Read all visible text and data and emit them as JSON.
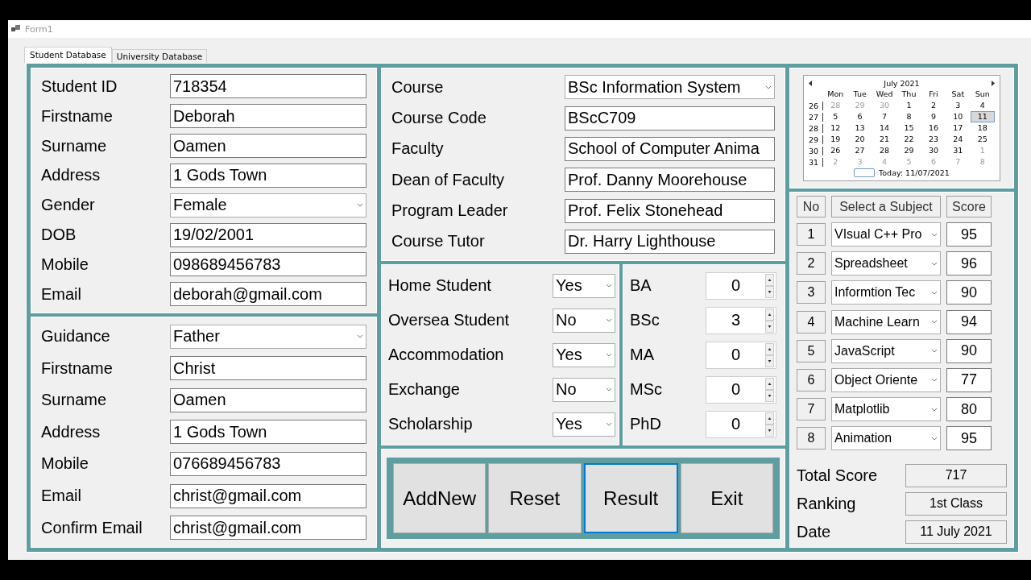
{
  "window": {
    "title": "Form1"
  },
  "tabs": [
    {
      "label": "Student Database",
      "selected": true
    },
    {
      "label": "University Database",
      "selected": false
    }
  ],
  "student": [
    {
      "label": "Student ID",
      "kind": "text",
      "value": "718354"
    },
    {
      "label": "Firstname",
      "kind": "text",
      "value": "Deborah"
    },
    {
      "label": "Surname",
      "kind": "text",
      "value": "Oamen"
    },
    {
      "label": "Address",
      "kind": "text",
      "value": "1 Gods Town"
    },
    {
      "label": "Gender",
      "kind": "dropdown",
      "value": "Female"
    },
    {
      "label": "DOB",
      "kind": "text",
      "value": "19/02/2001"
    },
    {
      "label": "Mobile",
      "kind": "text",
      "value": "098689456783"
    },
    {
      "label": "Email",
      "kind": "text",
      "value": "deborah@gmail.com"
    }
  ],
  "guardian": [
    {
      "label": "Guidance",
      "kind": "dropdown",
      "value": "Father"
    },
    {
      "label": "Firstname",
      "kind": "text",
      "value": "Christ"
    },
    {
      "label": "Surname",
      "kind": "text",
      "value": "Oamen"
    },
    {
      "label": "Address",
      "kind": "text",
      "value": "1 Gods Town"
    },
    {
      "label": "Mobile",
      "kind": "text",
      "value": "076689456783"
    },
    {
      "label": "Email",
      "kind": "text",
      "value": "christ@gmail.com"
    },
    {
      "label": "Confirm Email",
      "kind": "text",
      "value": "christ@gmail.com"
    }
  ],
  "course": [
    {
      "label": "Course",
      "kind": "dropdown",
      "value": "BSc Information System"
    },
    {
      "label": "Course Code",
      "kind": "text",
      "value": "BScC709"
    },
    {
      "label": "Faculty",
      "kind": "text",
      "value": "School of Computer Anima"
    },
    {
      "label": "Dean of Faculty",
      "kind": "text",
      "value": "Prof. Danny Moorehouse"
    },
    {
      "label": "Program Leader",
      "kind": "text",
      "value": "Prof. Felix Stonehead"
    },
    {
      "label": "Course Tutor",
      "kind": "text",
      "value": "Dr. Harry Lighthouse"
    }
  ],
  "options": [
    {
      "label": "Home Student",
      "value": "Yes"
    },
    {
      "label": "Oversea Student",
      "value": "No"
    },
    {
      "label": "Accommodation",
      "value": "Yes"
    },
    {
      "label": "Exchange",
      "value": "No"
    },
    {
      "label": "Scholarship",
      "value": "Yes"
    }
  ],
  "degrees": [
    {
      "label": "BA",
      "value": "0"
    },
    {
      "label": "BSc",
      "value": "3"
    },
    {
      "label": "MA",
      "value": "0"
    },
    {
      "label": "MSc",
      "value": "0"
    },
    {
      "label": "PhD",
      "value": "0"
    }
  ],
  "buttons": [
    {
      "label": "AddNew",
      "focused": false
    },
    {
      "label": "Reset",
      "focused": false
    },
    {
      "label": "Result",
      "focused": true
    },
    {
      "label": "Exit",
      "focused": false
    }
  ],
  "calendar": {
    "month": "July 2021",
    "weekdays": [
      "Mon",
      "Tue",
      "Wed",
      "Thu",
      "Fri",
      "Sat",
      "Sun"
    ],
    "today": "Today: 11/07/2021",
    "weeks": [
      {
        "week": "26",
        "days": [
          {
            "day": "28",
            "muted": true,
            "selected": false
          },
          {
            "day": "29",
            "muted": true,
            "selected": false
          },
          {
            "day": "30",
            "muted": true,
            "selected": false
          },
          {
            "day": "1",
            "muted": false,
            "selected": false
          },
          {
            "day": "2",
            "muted": false,
            "selected": false
          },
          {
            "day": "3",
            "muted": false,
            "selected": false
          },
          {
            "day": "4",
            "muted": false,
            "selected": false
          }
        ]
      },
      {
        "week": "27",
        "days": [
          {
            "day": "5",
            "muted": false,
            "selected": false
          },
          {
            "day": "6",
            "muted": false,
            "selected": false
          },
          {
            "day": "7",
            "muted": false,
            "selected": false
          },
          {
            "day": "8",
            "muted": false,
            "selected": false
          },
          {
            "day": "9",
            "muted": false,
            "selected": false
          },
          {
            "day": "10",
            "muted": false,
            "selected": false
          },
          {
            "day": "11",
            "muted": false,
            "selected": true
          }
        ]
      },
      {
        "week": "28",
        "days": [
          {
            "day": "12",
            "muted": false,
            "selected": false
          },
          {
            "day": "13",
            "muted": false,
            "selected": false
          },
          {
            "day": "14",
            "muted": false,
            "selected": false
          },
          {
            "day": "15",
            "muted": false,
            "selected": false
          },
          {
            "day": "16",
            "muted": false,
            "selected": false
          },
          {
            "day": "17",
            "muted": false,
            "selected": false
          },
          {
            "day": "18",
            "muted": false,
            "selected": false
          }
        ]
      },
      {
        "week": "29",
        "days": [
          {
            "day": "19",
            "muted": false,
            "selected": false
          },
          {
            "day": "20",
            "muted": false,
            "selected": false
          },
          {
            "day": "21",
            "muted": false,
            "selected": false
          },
          {
            "day": "22",
            "muted": false,
            "selected": false
          },
          {
            "day": "23",
            "muted": false,
            "selected": false
          },
          {
            "day": "24",
            "muted": false,
            "selected": false
          },
          {
            "day": "25",
            "muted": false,
            "selected": false
          }
        ]
      },
      {
        "week": "30",
        "days": [
          {
            "day": "26",
            "muted": false,
            "selected": false
          },
          {
            "day": "27",
            "muted": false,
            "selected": false
          },
          {
            "day": "28",
            "muted": false,
            "selected": false
          },
          {
            "day": "29",
            "muted": false,
            "selected": false
          },
          {
            "day": "30",
            "muted": false,
            "selected": false
          },
          {
            "day": "31",
            "muted": false,
            "selected": false
          },
          {
            "day": "1",
            "muted": true,
            "selected": false
          }
        ]
      },
      {
        "week": "31",
        "days": [
          {
            "day": "2",
            "muted": true,
            "selected": false
          },
          {
            "day": "3",
            "muted": true,
            "selected": false
          },
          {
            "day": "4",
            "muted": true,
            "selected": false
          },
          {
            "day": "5",
            "muted": true,
            "selected": false
          },
          {
            "day": "6",
            "muted": true,
            "selected": false
          },
          {
            "day": "7",
            "muted": true,
            "selected": false
          },
          {
            "day": "8",
            "muted": true,
            "selected": false
          }
        ]
      }
    ]
  },
  "subjects": {
    "headers": [
      "No",
      "Select a Subject",
      "Score"
    ],
    "rows": [
      {
        "no": "1",
        "subject": "VIsual C++ Pro",
        "score": "95"
      },
      {
        "no": "2",
        "subject": "Spreadsheet",
        "score": "96"
      },
      {
        "no": "3",
        "subject": "Informtion Tec",
        "score": "90"
      },
      {
        "no": "4",
        "subject": "Machine Learn",
        "score": "94"
      },
      {
        "no": "5",
        "subject": "JavaScript",
        "score": "90"
      },
      {
        "no": "6",
        "subject": "Object Oriente",
        "score": "77"
      },
      {
        "no": "7",
        "subject": "Matplotlib",
        "score": "80"
      },
      {
        "no": "8",
        "subject": "Animation",
        "score": "95"
      }
    ]
  },
  "summary": [
    {
      "label": "Total Score",
      "value": "717"
    },
    {
      "label": "Ranking",
      "value": "1st Class"
    },
    {
      "label": "Date",
      "value": "11 July 2021"
    }
  ]
}
